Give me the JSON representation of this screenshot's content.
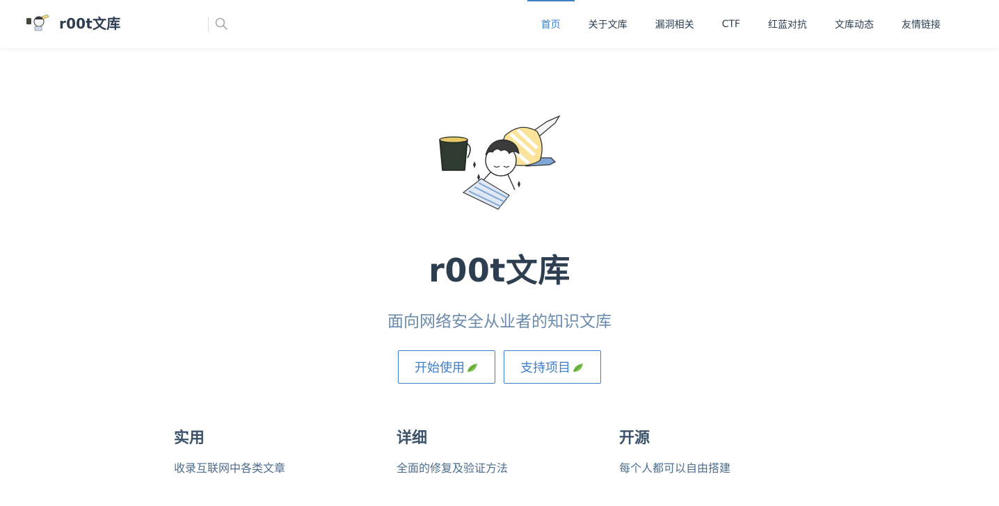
{
  "colors": {
    "accent": "#3e7fc9",
    "title": "#2c3e50",
    "desc": "#6a8bad"
  },
  "header": {
    "site_name": "r00t文库",
    "search": {
      "value": "",
      "placeholder": ""
    },
    "nav": [
      {
        "label": "首页",
        "active": true
      },
      {
        "label": "关于文库"
      },
      {
        "label": "漏洞相关"
      },
      {
        "label": "CTF"
      },
      {
        "label": "红蓝对抗"
      },
      {
        "label": "文库动态"
      },
      {
        "label": "友情链接"
      }
    ]
  },
  "hero": {
    "title": "r00t文库",
    "description": "面向网络安全从业者的知识文库",
    "actions": [
      {
        "label": "开始使用",
        "icon": "leaf-icon"
      },
      {
        "label": "支持项目",
        "icon": "leaf-icon"
      }
    ]
  },
  "features": [
    {
      "title": "实用",
      "details": "收录互联网中各类文章"
    },
    {
      "title": "详细",
      "details": "全面的修复及验证方法"
    },
    {
      "title": "开源",
      "details": "每个人都可以自由搭建"
    }
  ]
}
